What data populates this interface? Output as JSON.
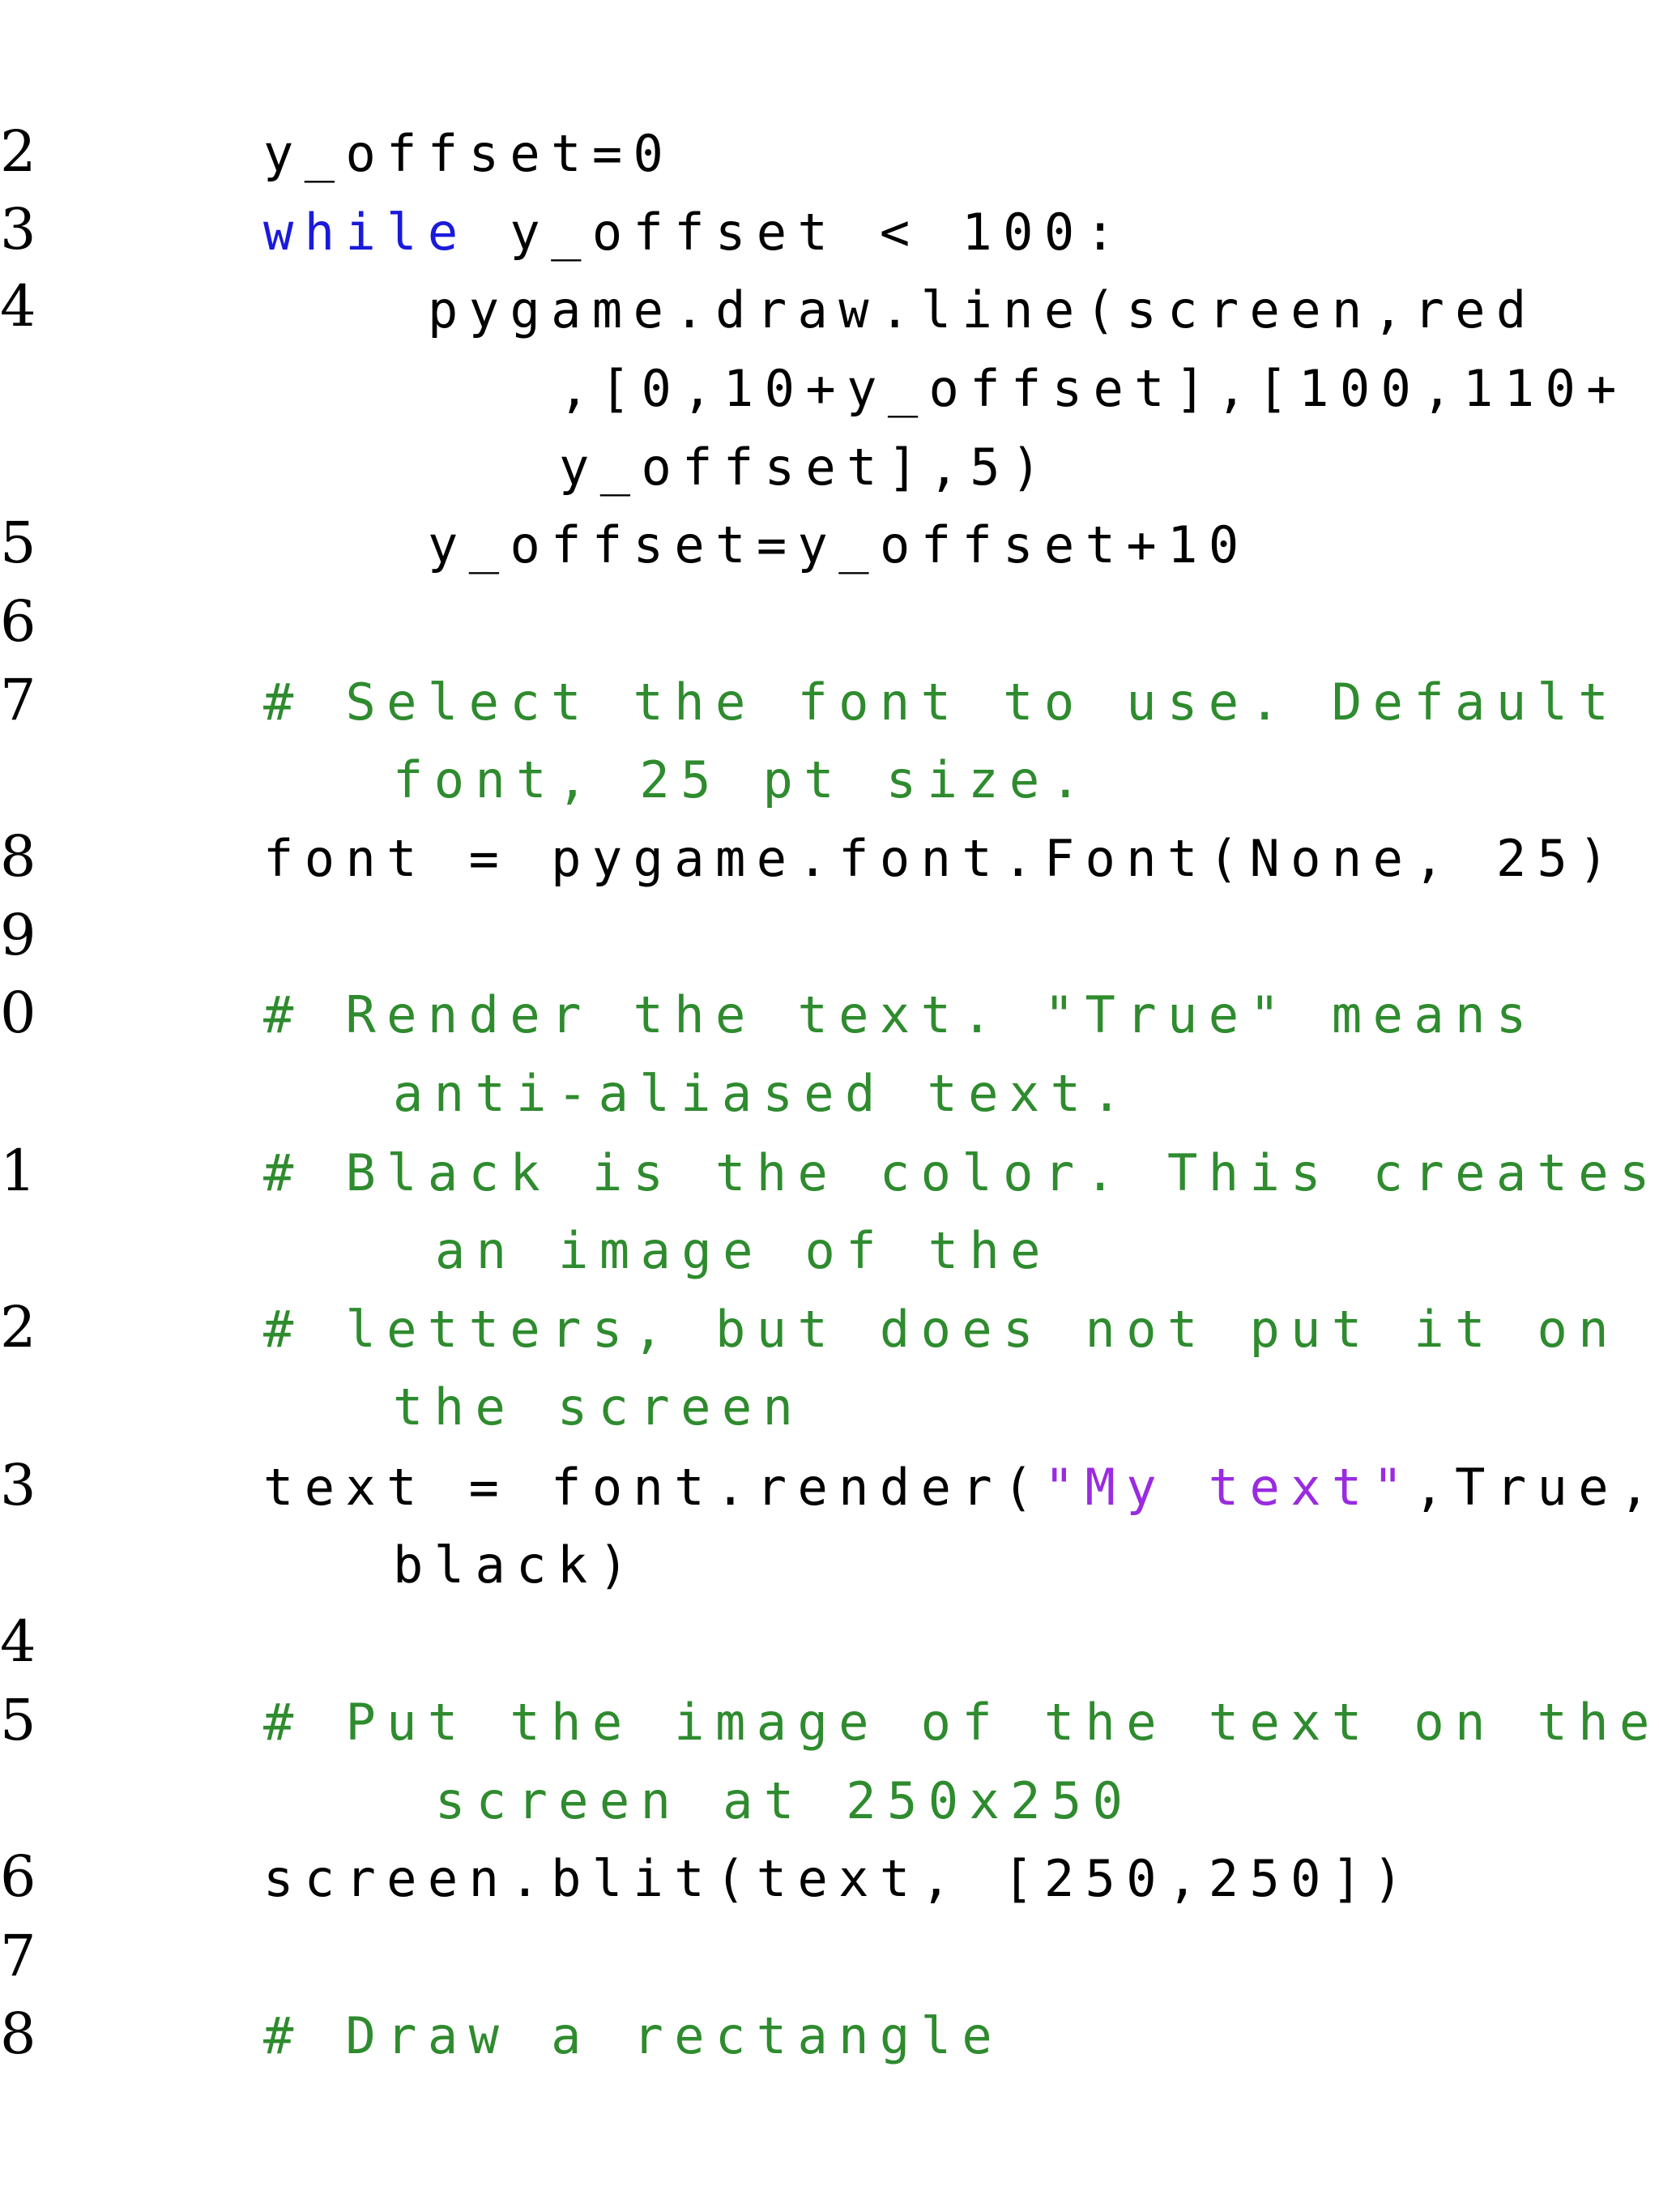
{
  "colors": {
    "text": "#000000",
    "keyword": "#1a1adb",
    "comment": "#2e8b2e",
    "string": "#9a2be0",
    "background": "#ffffff"
  },
  "line_numbers": [
    "2",
    "3",
    "4",
    "5",
    "6",
    "7",
    "8",
    "9",
    "0",
    "1",
    "2",
    "3",
    "4",
    "5",
    "6",
    "7",
    "8"
  ],
  "code": {
    "l2": "y_offset=0",
    "l3_kw": "while",
    "l3_rest": " y_offset < 100:",
    "l4_a": "pygame.draw.line(screen,red",
    "l4_b": ",[0,10+y_offset],[100,110+",
    "l4_c": "y_offset],5)",
    "l5": "y_offset=y_offset+10",
    "l7_a": "# Select the font to use. Default",
    "l7_b": "font, 25 pt size.",
    "l8": "font = pygame.font.Font(None, 25)",
    "l10_a": "# Render the text. \"True\" means",
    "l10_b": "anti-aliased text.",
    "l11_a": "# Black is the color. This creates",
    "l11_b": "an image of the",
    "l12_a": "# letters, but does not put it on",
    "l12_b": "the screen",
    "l13_pre": "text = font.render(",
    "l13_str": "\"My text\"",
    "l13_post": ",True,",
    "l13_b": "black)",
    "l15_a": "# Put the image of the text on the",
    "l15_b": "screen at 250x250",
    "l16": "screen.blit(text, [250,250])",
    "l18": "# Draw a rectangle"
  }
}
